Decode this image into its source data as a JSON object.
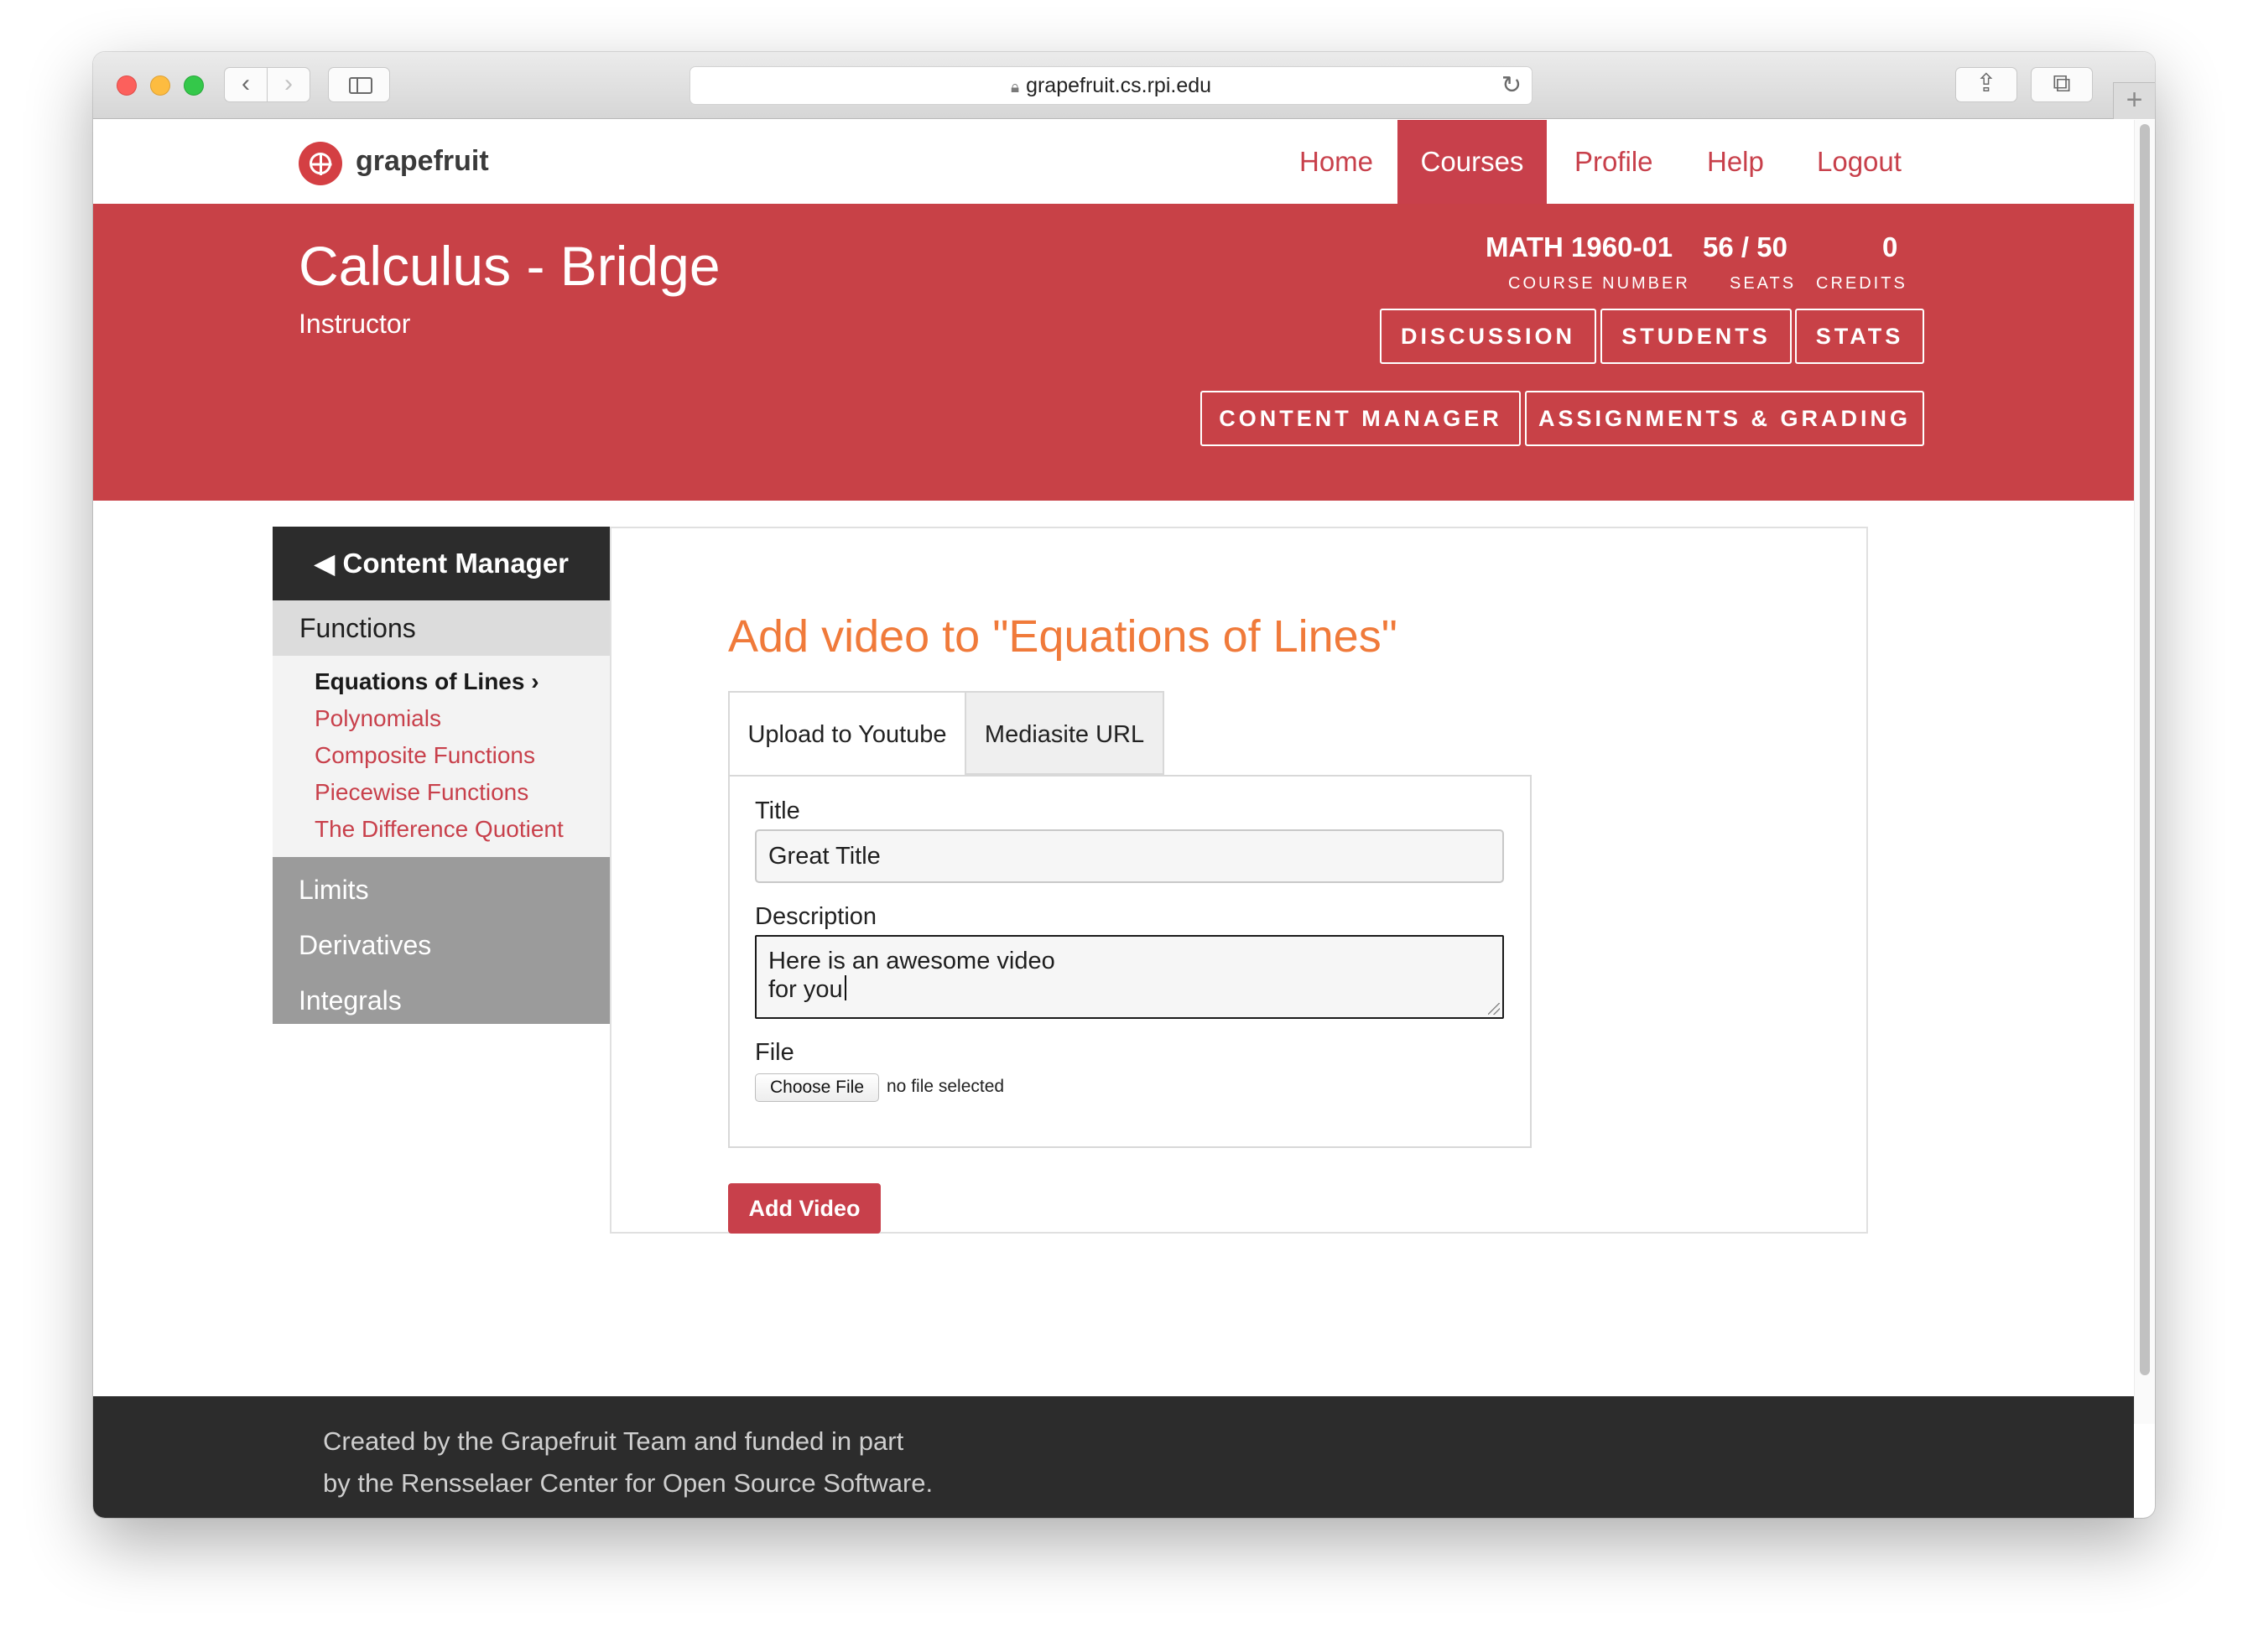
{
  "browser": {
    "url": "grapefruit.cs.rpi.edu"
  },
  "site": {
    "brand": "grapefruit",
    "nav": [
      {
        "label": "Home"
      },
      {
        "label": "Courses",
        "active": true
      },
      {
        "label": "Profile"
      },
      {
        "label": "Help"
      },
      {
        "label": "Logout"
      }
    ]
  },
  "course": {
    "title": "Calculus - Bridge",
    "role": "Instructor",
    "stats": [
      {
        "value": "MATH 1960-01",
        "label": "COURSE NUMBER"
      },
      {
        "value": "56 / 50",
        "label": "SEATS"
      },
      {
        "value": "0",
        "label": "CREDITS"
      }
    ],
    "buttons_row1": [
      "DISCUSSION",
      "STUDENTS",
      "STATS"
    ],
    "buttons_row2": [
      "CONTENT MANAGER",
      "ASSIGNMENTS & GRADING"
    ]
  },
  "sidebar": {
    "header": "◀ Content Manager",
    "active_section": "Functions",
    "items": [
      {
        "label": "Equations of Lines ›",
        "current": true
      },
      {
        "label": "Polynomials"
      },
      {
        "label": "Composite Functions"
      },
      {
        "label": "Piecewise Functions"
      },
      {
        "label": "The Difference Quotient"
      }
    ],
    "sections": [
      "Limits",
      "Derivatives",
      "Integrals"
    ]
  },
  "form": {
    "heading": "Add video to \"Equations of Lines\"",
    "tabs": [
      {
        "label": "Upload to Youtube",
        "active": true
      },
      {
        "label": "Mediasite URL"
      }
    ],
    "title_label": "Title",
    "title_value": "Great Title",
    "description_label": "Description",
    "description_lines": [
      "Here is an awesome video",
      "for you"
    ],
    "file_label": "File",
    "file_button": "Choose File",
    "file_status": "no file selected",
    "submit_label": "Add Video"
  },
  "footer": {
    "line1": "Created by the Grapefruit Team and funded in part",
    "line2": "by the Rensselaer Center for Open Source Software."
  },
  "colors": {
    "brand_red": "#c8404b",
    "heading_orange": "#f07a3a",
    "footer_dark": "#2c2c2c"
  },
  "icons": [
    "back-arrow-icon",
    "forward-arrow-icon",
    "sidebar-icon",
    "lock-icon",
    "reload-icon",
    "share-icon",
    "tabs-icon",
    "new-tab-icon",
    "grapefruit-logo-icon"
  ]
}
